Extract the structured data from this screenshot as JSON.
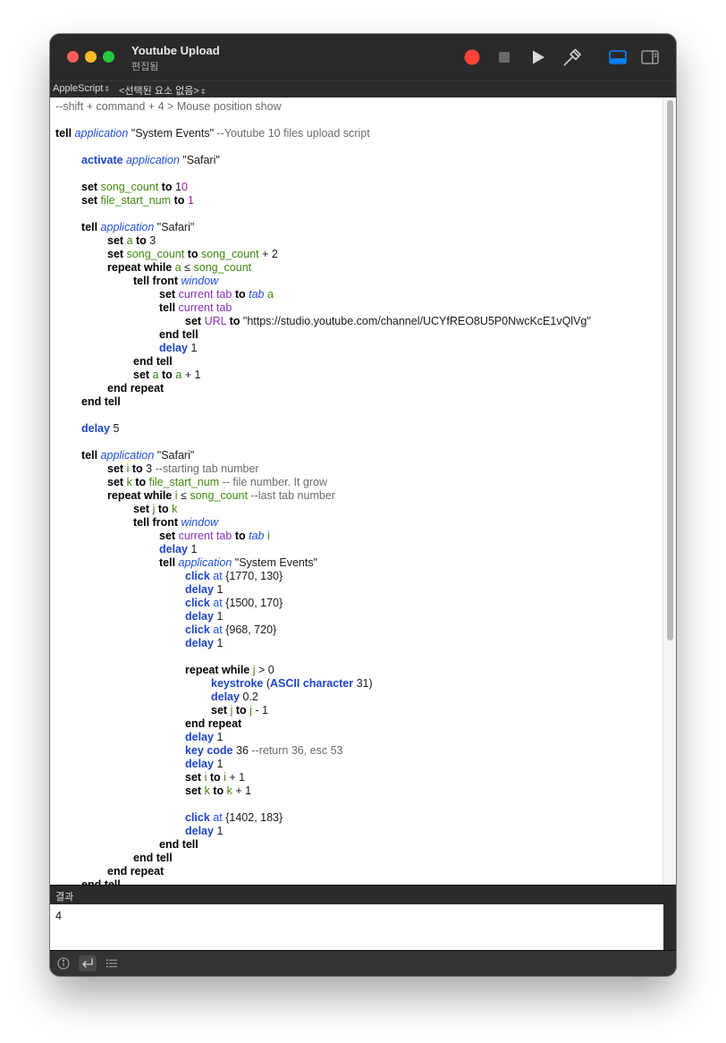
{
  "window": {
    "title": "Youtube Upload",
    "subtitle": "편집됨"
  },
  "toolbar": {
    "icons": [
      "record-icon",
      "stop-icon",
      "run-icon",
      "compile-icon",
      "log-view-icon",
      "sidebar-icon"
    ],
    "accent_color": "#0a84ff",
    "record_color": "#ff453a"
  },
  "navbar": {
    "language": "AppleScript",
    "element_selector": "<선택된 요소 없음>"
  },
  "editor": {
    "scroll_fraction_visible": 0.68,
    "lines": [
      [
        [
          "c",
          "--shift + command + 4 > Mouse position show"
        ]
      ],
      [],
      [
        [
          "k",
          "tell"
        ],
        [
          "t",
          " "
        ],
        [
          "cl",
          "application"
        ],
        [
          "t",
          " \"System Events\" "
        ],
        [
          "c",
          "--Youtube 10 files upload script"
        ]
      ],
      [],
      [
        [
          "t",
          "\t"
        ],
        [
          "cm",
          "activate"
        ],
        [
          "t",
          " "
        ],
        [
          "cl",
          "application"
        ],
        [
          "t",
          " \"Safari\""
        ]
      ],
      [],
      [
        [
          "t",
          "\t"
        ],
        [
          "k",
          "set"
        ],
        [
          "t",
          " "
        ],
        [
          "v",
          "song_count"
        ],
        [
          "t",
          " "
        ],
        [
          "k",
          "to"
        ],
        [
          "t",
          " 1"
        ],
        [
          "n",
          "0"
        ]
      ],
      [
        [
          "t",
          "\t"
        ],
        [
          "k",
          "set"
        ],
        [
          "t",
          " "
        ],
        [
          "v",
          "file_start_num"
        ],
        [
          "t",
          " "
        ],
        [
          "k",
          "to"
        ],
        [
          "t",
          " "
        ],
        [
          "n",
          "1"
        ]
      ],
      [],
      [
        [
          "t",
          "\t"
        ],
        [
          "k",
          "tell"
        ],
        [
          "t",
          " "
        ],
        [
          "cl",
          "application"
        ],
        [
          "t",
          " \"Safari\""
        ]
      ],
      [
        [
          "t",
          "\t\t"
        ],
        [
          "k",
          "set"
        ],
        [
          "t",
          " "
        ],
        [
          "v",
          "a"
        ],
        [
          "t",
          " "
        ],
        [
          "k",
          "to"
        ],
        [
          "t",
          " 3"
        ]
      ],
      [
        [
          "t",
          "\t\t"
        ],
        [
          "k",
          "set"
        ],
        [
          "t",
          " "
        ],
        [
          "v",
          "song_count"
        ],
        [
          "t",
          " "
        ],
        [
          "k",
          "to"
        ],
        [
          "t",
          " "
        ],
        [
          "v",
          "song_count"
        ],
        [
          "t",
          " + 2"
        ]
      ],
      [
        [
          "t",
          "\t\t"
        ],
        [
          "k",
          "repeat while"
        ],
        [
          "t",
          " "
        ],
        [
          "v",
          "a"
        ],
        [
          "t",
          " ≤ "
        ],
        [
          "v",
          "song_count"
        ]
      ],
      [
        [
          "t",
          "\t\t\t"
        ],
        [
          "k",
          "tell"
        ],
        [
          "t",
          " "
        ],
        [
          "k",
          "front"
        ],
        [
          "t",
          " "
        ],
        [
          "cl",
          "window"
        ]
      ],
      [
        [
          "t",
          "\t\t\t\t"
        ],
        [
          "k",
          "set"
        ],
        [
          "t",
          " "
        ],
        [
          "p",
          "current tab"
        ],
        [
          "t",
          " "
        ],
        [
          "k",
          "to"
        ],
        [
          "t",
          " "
        ],
        [
          "cl",
          "tab"
        ],
        [
          "t",
          " "
        ],
        [
          "v",
          "a"
        ]
      ],
      [
        [
          "t",
          "\t\t\t\t"
        ],
        [
          "k",
          "tell"
        ],
        [
          "t",
          " "
        ],
        [
          "p",
          "current tab"
        ]
      ],
      [
        [
          "t",
          "\t\t\t\t\t"
        ],
        [
          "k",
          "set"
        ],
        [
          "t",
          " "
        ],
        [
          "p",
          "URL"
        ],
        [
          "t",
          " "
        ],
        [
          "k",
          "to"
        ],
        [
          "t",
          " \"https://studio.youtube.com/channel/UCYfREO8U5P0NwcKcE1vQlVg\""
        ]
      ],
      [
        [
          "t",
          "\t\t\t\t"
        ],
        [
          "k",
          "end tell"
        ]
      ],
      [
        [
          "t",
          "\t\t\t\t"
        ],
        [
          "cm",
          "delay"
        ],
        [
          "t",
          " 1"
        ]
      ],
      [
        [
          "t",
          "\t\t\t"
        ],
        [
          "k",
          "end tell"
        ]
      ],
      [
        [
          "t",
          "\t\t\t"
        ],
        [
          "k",
          "set"
        ],
        [
          "t",
          " "
        ],
        [
          "v",
          "a"
        ],
        [
          "t",
          " "
        ],
        [
          "k",
          "to"
        ],
        [
          "t",
          " "
        ],
        [
          "v",
          "a"
        ],
        [
          "t",
          " + 1"
        ]
      ],
      [
        [
          "t",
          "\t\t"
        ],
        [
          "k",
          "end repeat"
        ]
      ],
      [
        [
          "t",
          "\t"
        ],
        [
          "k",
          "end tell"
        ]
      ],
      [],
      [
        [
          "t",
          "\t"
        ],
        [
          "cm",
          "delay"
        ],
        [
          "t",
          " 5"
        ]
      ],
      [],
      [
        [
          "t",
          "\t"
        ],
        [
          "k",
          "tell"
        ],
        [
          "t",
          " "
        ],
        [
          "cl",
          "application"
        ],
        [
          "t",
          " \"Safari\""
        ]
      ],
      [
        [
          "t",
          "\t\t"
        ],
        [
          "k",
          "set"
        ],
        [
          "t",
          " "
        ],
        [
          "v",
          "i"
        ],
        [
          "t",
          " "
        ],
        [
          "k",
          "to"
        ],
        [
          "t",
          " 3 "
        ],
        [
          "c",
          "--starting tab number"
        ]
      ],
      [
        [
          "t",
          "\t\t"
        ],
        [
          "k",
          "set"
        ],
        [
          "t",
          " "
        ],
        [
          "v",
          "k"
        ],
        [
          "t",
          " "
        ],
        [
          "k",
          "to"
        ],
        [
          "t",
          " "
        ],
        [
          "v",
          "file_start_num"
        ],
        [
          "t",
          " "
        ],
        [
          "c",
          "-- file number. It grow"
        ]
      ],
      [
        [
          "t",
          "\t\t"
        ],
        [
          "k",
          "repeat while"
        ],
        [
          "t",
          " "
        ],
        [
          "v",
          "i"
        ],
        [
          "t",
          " ≤ "
        ],
        [
          "v",
          "song_count"
        ],
        [
          "t",
          " "
        ],
        [
          "c",
          "--last tab number"
        ]
      ],
      [
        [
          "t",
          "\t\t\t"
        ],
        [
          "k",
          "set"
        ],
        [
          "t",
          " "
        ],
        [
          "v",
          "j"
        ],
        [
          "t",
          " "
        ],
        [
          "k",
          "to"
        ],
        [
          "t",
          " "
        ],
        [
          "v",
          "k"
        ]
      ],
      [
        [
          "t",
          "\t\t\t"
        ],
        [
          "k",
          "tell"
        ],
        [
          "t",
          " "
        ],
        [
          "k",
          "front"
        ],
        [
          "t",
          " "
        ],
        [
          "cl",
          "window"
        ]
      ],
      [
        [
          "t",
          "\t\t\t\t"
        ],
        [
          "k",
          "set"
        ],
        [
          "t",
          " "
        ],
        [
          "p",
          "current tab"
        ],
        [
          "t",
          " "
        ],
        [
          "k",
          "to"
        ],
        [
          "t",
          " "
        ],
        [
          "cl",
          "tab"
        ],
        [
          "t",
          " "
        ],
        [
          "v",
          "i"
        ]
      ],
      [
        [
          "t",
          "\t\t\t\t"
        ],
        [
          "cm",
          "delay"
        ],
        [
          "t",
          " 1"
        ]
      ],
      [
        [
          "t",
          "\t\t\t\t"
        ],
        [
          "k",
          "tell"
        ],
        [
          "t",
          " "
        ],
        [
          "cl",
          "application"
        ],
        [
          "t",
          " \"System Events\""
        ]
      ],
      [
        [
          "t",
          "\t\t\t\t\t"
        ],
        [
          "cm",
          "click"
        ],
        [
          "t",
          " "
        ],
        [
          "pa",
          "at"
        ],
        [
          "t",
          " {1770, 130}"
        ]
      ],
      [
        [
          "t",
          "\t\t\t\t\t"
        ],
        [
          "cm",
          "delay"
        ],
        [
          "t",
          " 1"
        ]
      ],
      [
        [
          "t",
          "\t\t\t\t\t"
        ],
        [
          "cm",
          "click"
        ],
        [
          "t",
          " "
        ],
        [
          "pa",
          "at"
        ],
        [
          "t",
          " {1500, 170}"
        ]
      ],
      [
        [
          "t",
          "\t\t\t\t\t"
        ],
        [
          "cm",
          "delay"
        ],
        [
          "t",
          " 1"
        ]
      ],
      [
        [
          "t",
          "\t\t\t\t\t"
        ],
        [
          "cm",
          "click"
        ],
        [
          "t",
          " "
        ],
        [
          "pa",
          "at"
        ],
        [
          "t",
          " {968, 720}"
        ]
      ],
      [
        [
          "t",
          "\t\t\t\t\t"
        ],
        [
          "cm",
          "delay"
        ],
        [
          "t",
          " 1"
        ]
      ],
      [],
      [
        [
          "t",
          "\t\t\t\t\t"
        ],
        [
          "k",
          "repeat while"
        ],
        [
          "t",
          " "
        ],
        [
          "v",
          "j"
        ],
        [
          "t",
          " > 0"
        ]
      ],
      [
        [
          "t",
          "\t\t\t\t\t\t"
        ],
        [
          "cm",
          "keystroke"
        ],
        [
          "t",
          " ("
        ],
        [
          "cm",
          "ASCII character"
        ],
        [
          "t",
          " 31)"
        ]
      ],
      [
        [
          "t",
          "\t\t\t\t\t\t"
        ],
        [
          "cm",
          "delay"
        ],
        [
          "t",
          " 0.2"
        ]
      ],
      [
        [
          "t",
          "\t\t\t\t\t\t"
        ],
        [
          "k",
          "set"
        ],
        [
          "t",
          " "
        ],
        [
          "v",
          "j"
        ],
        [
          "t",
          " "
        ],
        [
          "k",
          "to"
        ],
        [
          "t",
          " "
        ],
        [
          "v",
          "j"
        ],
        [
          "t",
          " - 1"
        ]
      ],
      [
        [
          "t",
          "\t\t\t\t\t"
        ],
        [
          "k",
          "end repeat"
        ]
      ],
      [
        [
          "t",
          "\t\t\t\t\t"
        ],
        [
          "cm",
          "delay"
        ],
        [
          "t",
          " 1"
        ]
      ],
      [
        [
          "t",
          "\t\t\t\t\t"
        ],
        [
          "cm",
          "key code"
        ],
        [
          "t",
          " 36 "
        ],
        [
          "c",
          "--return 36, esc 53"
        ]
      ],
      [
        [
          "t",
          "\t\t\t\t\t"
        ],
        [
          "cm",
          "delay"
        ],
        [
          "t",
          " 1"
        ]
      ],
      [
        [
          "t",
          "\t\t\t\t\t"
        ],
        [
          "k",
          "set"
        ],
        [
          "t",
          " "
        ],
        [
          "v",
          "i"
        ],
        [
          "t",
          " "
        ],
        [
          "k",
          "to"
        ],
        [
          "t",
          " "
        ],
        [
          "v",
          "i"
        ],
        [
          "t",
          " + 1"
        ]
      ],
      [
        [
          "t",
          "\t\t\t\t\t"
        ],
        [
          "k",
          "set"
        ],
        [
          "t",
          " "
        ],
        [
          "v",
          "k"
        ],
        [
          "t",
          " "
        ],
        [
          "k",
          "to"
        ],
        [
          "t",
          " "
        ],
        [
          "v",
          "k"
        ],
        [
          "t",
          " + 1"
        ]
      ],
      [],
      [
        [
          "t",
          "\t\t\t\t\t"
        ],
        [
          "cm",
          "click"
        ],
        [
          "t",
          " "
        ],
        [
          "pa",
          "at"
        ],
        [
          "t",
          " {1402, 183}"
        ]
      ],
      [
        [
          "t",
          "\t\t\t\t\t"
        ],
        [
          "cm",
          "delay"
        ],
        [
          "t",
          " 1"
        ]
      ],
      [
        [
          "t",
          "\t\t\t\t"
        ],
        [
          "k",
          "end tell"
        ]
      ],
      [
        [
          "t",
          "\t\t\t"
        ],
        [
          "k",
          "end tell"
        ]
      ],
      [
        [
          "t",
          "\t\t"
        ],
        [
          "k",
          "end repeat"
        ]
      ],
      [
        [
          "t",
          "\t"
        ],
        [
          "k",
          "end tell"
        ]
      ]
    ]
  },
  "result": {
    "header_label": "결과",
    "value": "4"
  },
  "bottom_bar": {
    "icons": [
      "info-icon",
      "return-value-icon",
      "list-icon"
    ]
  }
}
